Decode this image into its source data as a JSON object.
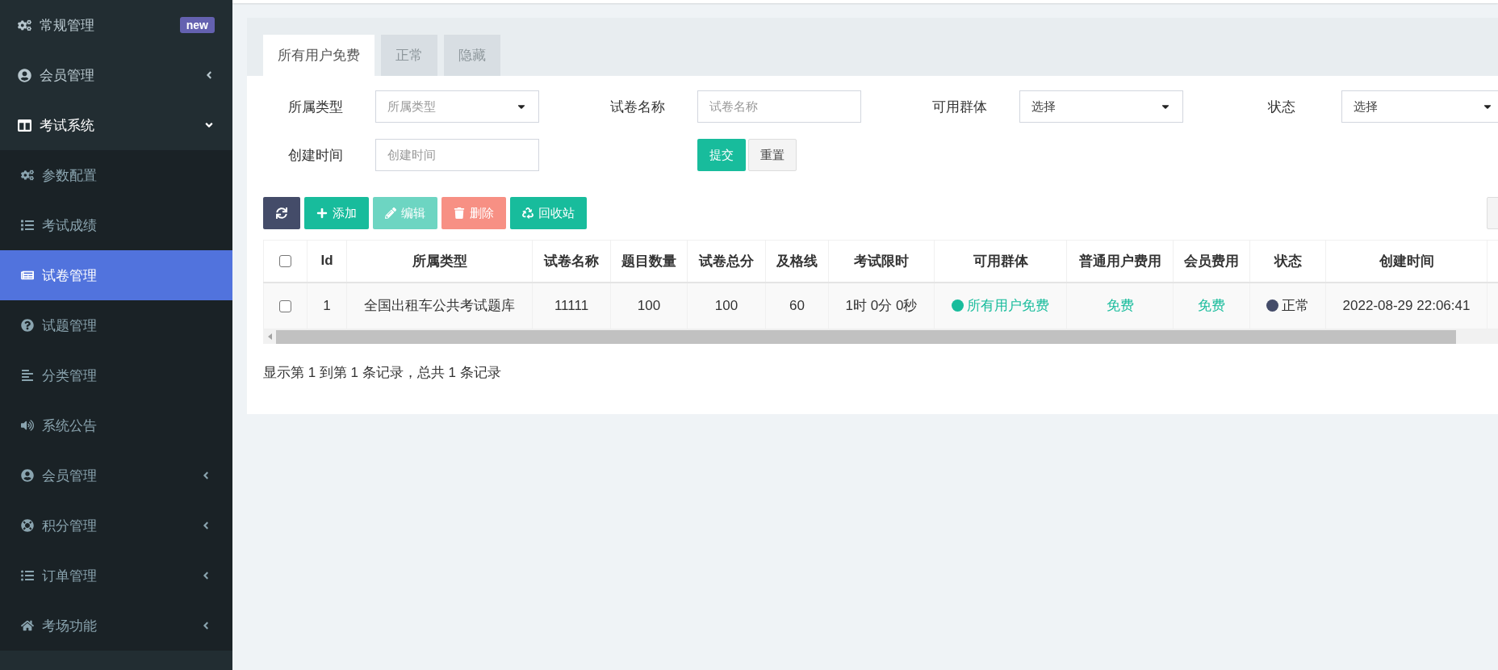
{
  "sidebar": {
    "items": [
      {
        "label": "常规管理",
        "badge": "new",
        "selected": false
      },
      {
        "label": "会员管理",
        "expanded": false,
        "selected": false
      },
      {
        "label": "考试系统",
        "expanded": true,
        "selected": false,
        "children": [
          {
            "label": "参数配置",
            "selected": false
          },
          {
            "label": "考试成绩",
            "selected": false
          },
          {
            "label": "试卷管理",
            "selected": true
          },
          {
            "label": "试题管理",
            "selected": false
          },
          {
            "label": "分类管理",
            "selected": false
          },
          {
            "label": "系统公告",
            "selected": false
          },
          {
            "label": "会员管理",
            "expanded": false,
            "selected": false
          },
          {
            "label": "积分管理",
            "expanded": false,
            "selected": false
          },
          {
            "label": "订单管理",
            "expanded": false,
            "selected": false
          },
          {
            "label": "考场功能",
            "expanded": false,
            "selected": false
          }
        ]
      }
    ]
  },
  "tabs": [
    {
      "label": "所有用户免费",
      "selected": true
    },
    {
      "label": "正常",
      "selected": false
    },
    {
      "label": "隐藏",
      "selected": false
    }
  ],
  "filters": [
    {
      "label": "所属类型",
      "kind": "select",
      "placeholder": "所属类型"
    },
    {
      "label": "试卷名称",
      "kind": "input",
      "placeholder": "试卷名称"
    },
    {
      "label": "可用群体",
      "kind": "select",
      "value": "选择"
    },
    {
      "label": "状态",
      "kind": "select",
      "value": "选择"
    },
    {
      "label": "创建时间",
      "kind": "input",
      "placeholder": "创建时间"
    }
  ],
  "form_buttons": [
    {
      "label": "提交",
      "kind": "primary"
    },
    {
      "label": "重置",
      "kind": "default"
    }
  ],
  "toolbar": [
    {
      "kind": "refresh"
    },
    {
      "kind": "add",
      "label": "添加"
    },
    {
      "kind": "edit",
      "label": "编辑"
    },
    {
      "kind": "delete",
      "label": "删除"
    },
    {
      "kind": "recycle",
      "label": "回收站"
    }
  ],
  "table": {
    "select_all": {
      "checked": false
    },
    "columns": [
      "Id",
      "所属类型",
      "试卷名称",
      "题目数量",
      "试卷总分",
      "及格线",
      "考试限时",
      "可用群体",
      "普通用户费用",
      "会员费用",
      "状态",
      "创建时间"
    ],
    "rows": [
      {
        "checked": false,
        "cells": [
          {
            "kind": "text",
            "text": "1"
          },
          {
            "kind": "text",
            "text": "全国出租车公共考试题库"
          },
          {
            "kind": "text",
            "text": "11111"
          },
          {
            "kind": "text",
            "text": "100"
          },
          {
            "kind": "text",
            "text": "100"
          },
          {
            "kind": "text",
            "text": "60"
          },
          {
            "kind": "text",
            "text": "1时 0分 0秒"
          },
          {
            "kind": "dot",
            "text": "所有用户免费",
            "color": "#18bc9c"
          },
          {
            "kind": "fee",
            "text": "免费"
          },
          {
            "kind": "fee",
            "text": "免费"
          },
          {
            "kind": "dot",
            "text": "正常",
            "color": "#444c69"
          },
          {
            "kind": "text",
            "text": "2022-08-29 22:06:41"
          }
        ]
      }
    ]
  },
  "pagination": {
    "summary": "显示第 1 到第 1 条记录，总共 1 条记录"
  }
}
